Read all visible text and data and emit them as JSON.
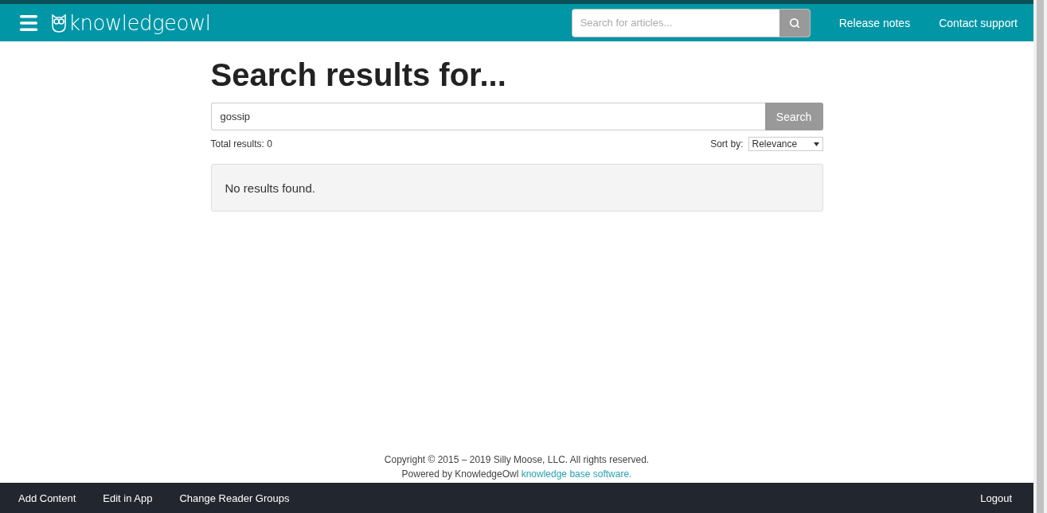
{
  "header": {
    "logo": "knowledgeowl",
    "search": {
      "placeholder": "Search for articles..."
    },
    "links": [
      "Release notes",
      "Contact support"
    ]
  },
  "page": {
    "title": "Search results for...",
    "query": "gossip",
    "search_button": "Search",
    "total": "Total results: 0",
    "sort_label": "Sort by:",
    "sort_value": "Relevance",
    "message": "No results found."
  },
  "footer": {
    "copyright": "Copyright © 2015 – 2019 Silly Moose, LLC. All rights reserved.",
    "powered": "Powered by KnowledgeOwl",
    "powered_link": "knowledge base software."
  },
  "bottom_bar": {
    "left": [
      "Add Content",
      "Edit in App",
      "Change Reader Groups"
    ],
    "right": "Logout"
  }
}
